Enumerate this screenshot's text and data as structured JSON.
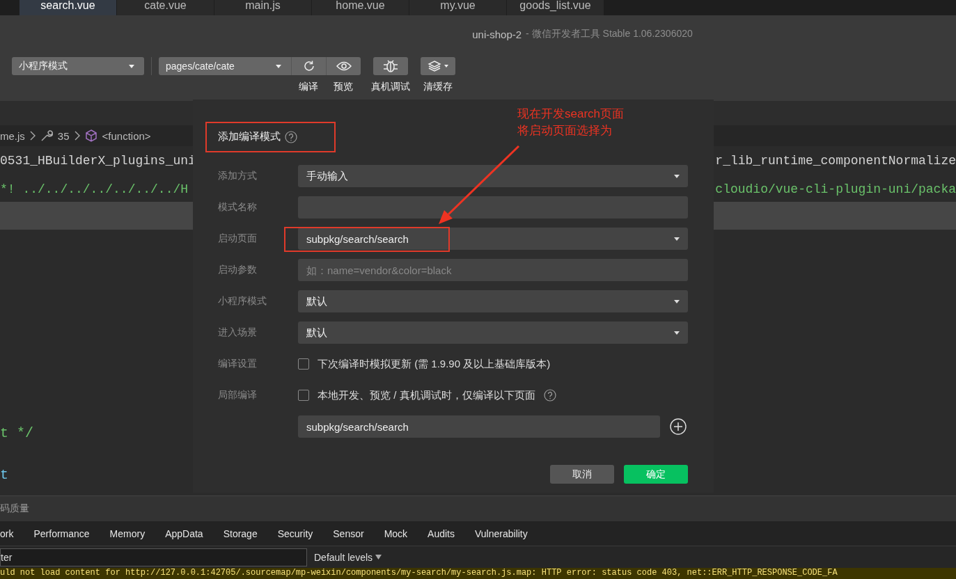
{
  "tabs": [
    {
      "label": "search.vue",
      "selected": true
    },
    {
      "label": "cate.vue",
      "selected": false
    },
    {
      "label": "main.js",
      "selected": false
    },
    {
      "label": "home.vue",
      "selected": false
    },
    {
      "label": "my.vue",
      "selected": false
    },
    {
      "label": "goods_list.vue",
      "selected": false
    }
  ],
  "window": {
    "title": "uni-shop-2",
    "subtitle": "- 微信开发者工具 Stable 1.06.2306020"
  },
  "toolbar": {
    "mode": "小程序模式",
    "page": "pages/cate/cate",
    "buttons": [
      {
        "label": "编译",
        "kind": "refresh"
      },
      {
        "label": "预览",
        "kind": "eye"
      },
      {
        "label": "真机调试",
        "kind": "bug"
      },
      {
        "label": "清缓存",
        "kind": "layers"
      }
    ]
  },
  "breadcrumb": {
    "file": "me.js",
    "line": "35",
    "symbol": "<function>"
  },
  "code": {
    "lines": [
      {
        "left": "0531_HBuilderX_plugins_uni",
        "right": "r_lib_runtime_componentNormalize",
        "kind": "plain"
      },
      {
        "left": "*! ../../../../../../../H",
        "right": "cloudio/vue-cli-plugin-uni/packa",
        "kind": "comment"
      }
    ],
    "lower_lines": [
      {
        "text": "t */",
        "kind": "comment"
      },
      {
        "text": "t",
        "kind": "keyword"
      }
    ]
  },
  "quality_bar": {
    "label": "码质量"
  },
  "devtools": {
    "tabs": [
      "ork",
      "Performance",
      "Memory",
      "AppData",
      "Storage",
      "Security",
      "Sensor",
      "Mock",
      "Audits",
      "Vulnerability"
    ],
    "filter": {
      "placeholder": "ter"
    },
    "levels": "Default levels",
    "message": "uld not load content for http://127.0.0.1:42705/.sourcemap/mp-weixin/components/my-search/my-search.js.map: HTTP error: status code 403, net::ERR_HTTP_RESPONSE_CODE_FA"
  },
  "dialog": {
    "title": "添加编译模式",
    "rows": [
      {
        "label": "添加方式",
        "kind": "select",
        "value": "手动输入"
      },
      {
        "label": "模式名称",
        "kind": "input"
      },
      {
        "label": "启动页面",
        "kind": "select",
        "value": "subpkg/search/search"
      },
      {
        "label": "启动参数",
        "kind": "input",
        "placeholder": "如：name=vendor&color=black"
      },
      {
        "label": "小程序模式",
        "kind": "select",
        "value": "默认"
      },
      {
        "label": "进入场景",
        "kind": "select",
        "value": "默认"
      },
      {
        "label": "编译设置",
        "kind": "checkbox",
        "text": "下次编译时模拟更新 (需 1.9.90 及以上基础库版本)",
        "checked": false,
        "help": false
      },
      {
        "label": "局部编译",
        "kind": "checkbox",
        "text": "本地开发、预览 / 真机调试时，仅编译以下页面",
        "checked": false,
        "help": true
      }
    ],
    "page_field": "subpkg/search/search",
    "buttons": [
      {
        "label": "取消",
        "kind": "cancel"
      },
      {
        "label": "确定",
        "kind": "confirm"
      }
    ]
  },
  "annotation": {
    "note": [
      "现在开发search页面",
      "将启动页面选择为"
    ]
  }
}
